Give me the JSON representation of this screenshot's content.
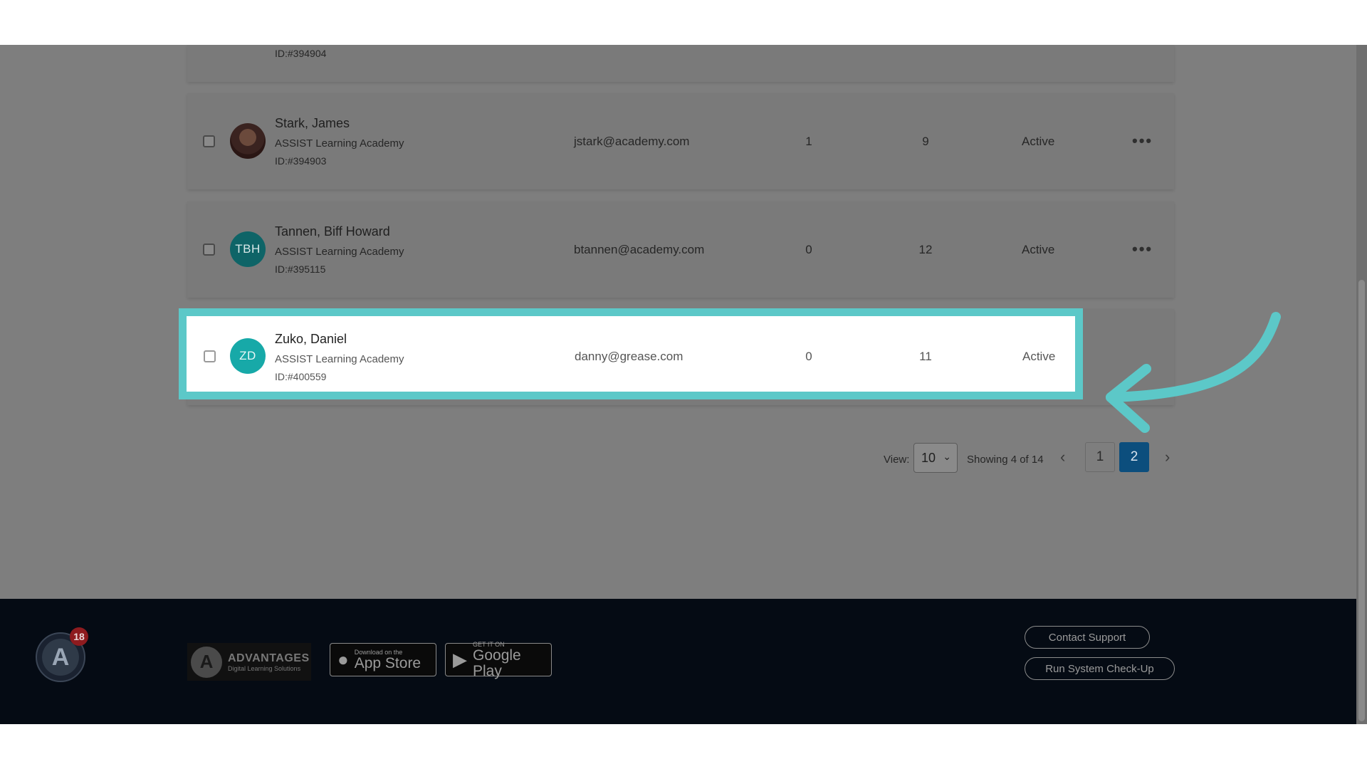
{
  "rows": [
    {
      "id": "ID:#394904"
    },
    {
      "name": "Stark, James",
      "org": "ASSIST Learning Academy",
      "id": "ID:#394903",
      "email": "jstark@academy.com",
      "col1": "1",
      "col2": "9",
      "status": "Active",
      "more": "•••"
    },
    {
      "initials": "TBH",
      "name": "Tannen, Biff Howard",
      "org": "ASSIST Learning Academy",
      "id": "ID:#395115",
      "email": "btannen@academy.com",
      "col1": "0",
      "col2": "12",
      "status": "Active",
      "more": "•••"
    },
    {
      "initials": "ZD",
      "name": "Zuko, Daniel",
      "org": "ASSIST Learning Academy",
      "id": "ID:#400559",
      "email": "danny@grease.com",
      "col1": "0",
      "col2": "11",
      "status": "Active"
    }
  ],
  "pagination": {
    "view_label": "View:",
    "view_value": "10",
    "showing": "Showing 4 of 14",
    "prev": "‹",
    "next": "›",
    "pages": [
      "1",
      "2"
    ],
    "active_page": "2"
  },
  "footer": {
    "badge_count": "18",
    "logo_letter": "A",
    "advantages_title": "ADVANTAGES",
    "advantages_sub": "Digital Learning Solutions",
    "app_store_small": "Download on the",
    "app_store_big": "App Store",
    "google_small": "GET IT ON",
    "google_big": "Google Play",
    "contact_support": "Contact Support",
    "system_check": "Run System Check-Up"
  },
  "colors": {
    "highlight": "#5cc8c8",
    "active_page": "#0c4e7d",
    "avatar_teal": "#17a9a8",
    "footer_bg": "#050b14"
  }
}
